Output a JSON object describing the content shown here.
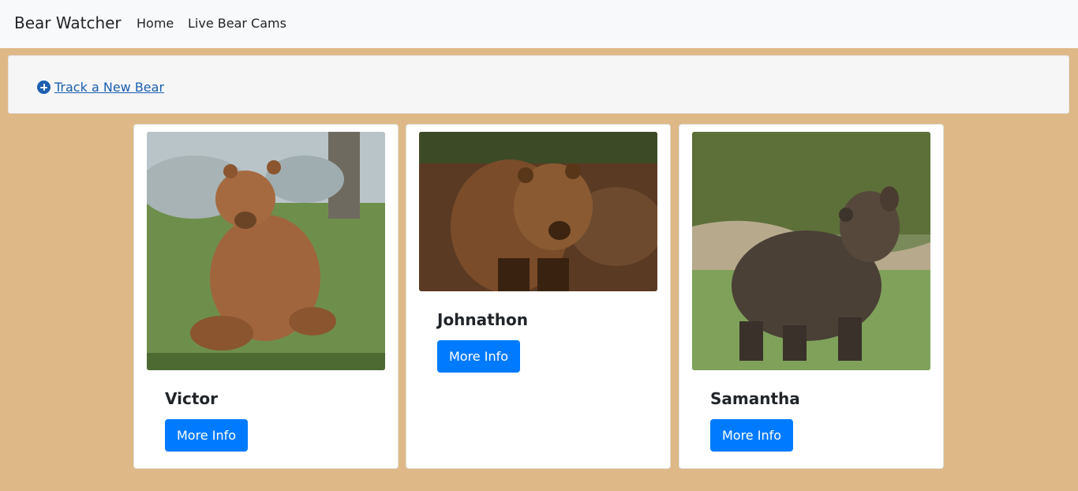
{
  "navbar": {
    "brand": "Bear Watcher",
    "links": [
      "Home",
      "Live Bear Cams"
    ]
  },
  "toolbar": {
    "track_link_label": "Track a New Bear",
    "track_link_icon": "plus-circle-icon"
  },
  "bears": [
    {
      "name": "Victor",
      "button_label": "More Info"
    },
    {
      "name": "Johnathon",
      "button_label": "More Info"
    },
    {
      "name": "Samantha",
      "button_label": "More Info"
    }
  ],
  "colors": {
    "page_background": "#deb887",
    "navbar_background": "#f8f9fa",
    "link": "#1b5fb0",
    "button": "#007bff"
  }
}
